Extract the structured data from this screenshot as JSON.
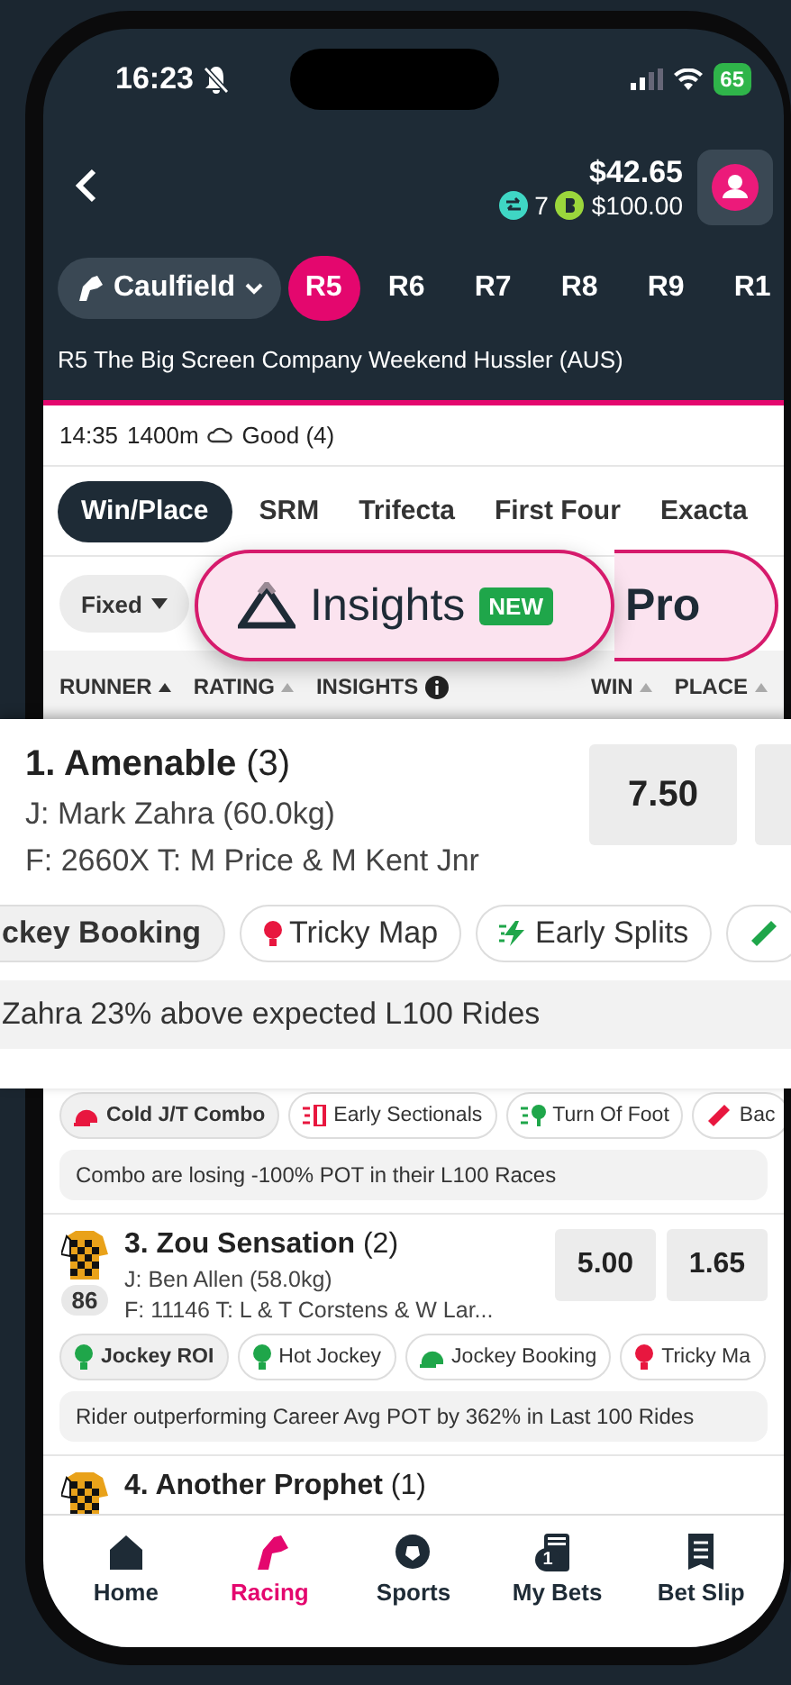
{
  "status_bar": {
    "time": "16:23",
    "battery": "65"
  },
  "header": {
    "balance": "$42.65",
    "bonus_count": "7",
    "bonus_cash": "$100.00"
  },
  "venue": {
    "label": "Caulfield"
  },
  "races": [
    {
      "label": "R5",
      "selected": true
    },
    {
      "label": "R6",
      "selected": false
    },
    {
      "label": "R7",
      "selected": false
    },
    {
      "label": "R8",
      "selected": false
    },
    {
      "label": "R9",
      "selected": false
    },
    {
      "label": "R1",
      "selected": false
    }
  ],
  "race_title": "R5 The Big Screen Company Weekend Hussler (AUS)",
  "race_info": {
    "time": "14:35",
    "distance": "1400m",
    "track": "Good (4)"
  },
  "bet_types": [
    {
      "label": "Win/Place",
      "selected": true
    },
    {
      "label": "SRM",
      "selected": false
    },
    {
      "label": "Trifecta",
      "selected": false
    },
    {
      "label": "First Four",
      "selected": false
    },
    {
      "label": "Exacta",
      "selected": false
    }
  ],
  "price_type": "Fixed",
  "insights_toggle": {
    "insights": "Insights",
    "badge": "NEW",
    "pro": "Pro"
  },
  "columns": [
    {
      "label": "RUNNER",
      "kind": "sort"
    },
    {
      "label": "RATING",
      "kind": "sort"
    },
    {
      "label": "INSIGHTS",
      "kind": "info"
    },
    {
      "label": "WIN",
      "kind": "sort"
    },
    {
      "label": "PLACE",
      "kind": "sort"
    }
  ],
  "highlighted_runner": {
    "name": "1. Amenable",
    "barrier": "(3)",
    "jockey": "J: Mark Zahra (60.0kg)",
    "form_trainer": "F: 2660X T: M Price & M Kent Jnr",
    "odds": [
      "7.50"
    ],
    "insights": [
      {
        "label": "ckey Booking",
        "kind": "none",
        "selected": true
      },
      {
        "label": "Tricky Map",
        "kind": "bulb",
        "color": "#e8173f",
        "selected": false
      },
      {
        "label": "Early Splits",
        "kind": "bolt",
        "color": "#1fa64a",
        "selected": false
      },
      {
        "kind": "ruler",
        "color": "#1fa64a",
        "selected": false
      }
    ],
    "comment": "Zahra 23% above expected L100 Rides"
  },
  "runners": [
    {
      "insights": [
        {
          "label": "Cold J/T Combo",
          "kind": "helmet",
          "color": "#e8173f",
          "selected": true
        },
        {
          "label": "Early Sectionals",
          "kind": "sectional",
          "color": "#e8173f",
          "selected": false
        },
        {
          "label": "Turn Of Foot",
          "kind": "pin",
          "color": "#1fa64a",
          "selected": false
        },
        {
          "label": "Bac",
          "kind": "ticket",
          "color": "#e8173f",
          "selected": false
        }
      ],
      "comment": "Combo are losing -100% POT in their L100 Races"
    },
    {
      "name": "3. Zou Sensation",
      "barrier": "(2)",
      "rating": "86",
      "jockey": "J: Ben Allen (58.0kg)",
      "form_trainer": "F: 11146  T: L & T Corstens & W Lar...",
      "odds": [
        "5.00",
        "1.65"
      ],
      "insights": [
        {
          "label": "Jockey ROI",
          "kind": "bulb",
          "color": "#1fa64a",
          "selected": true
        },
        {
          "label": "Hot Jockey",
          "kind": "bulb",
          "color": "#1fa64a",
          "selected": false
        },
        {
          "label": "Jockey Booking",
          "kind": "helmet",
          "color": "#1fa64a",
          "selected": false
        },
        {
          "label": "Tricky Ma",
          "kind": "bulb",
          "color": "#e8173f",
          "selected": false
        }
      ],
      "comment": "Rider outperforming Career Avg POT by 362% in Last 100 Rides"
    },
    {
      "name": "4. Another Prophet",
      "barrier": "(1)"
    }
  ],
  "nav": [
    {
      "label": "Home",
      "kind": "home",
      "selected": false
    },
    {
      "label": "Racing",
      "kind": "horse",
      "selected": true
    },
    {
      "label": "Sports",
      "kind": "ball",
      "selected": false
    },
    {
      "label": "My Bets",
      "kind": "bets",
      "badge": "1",
      "selected": false
    },
    {
      "label": "Bet Slip",
      "kind": "slip",
      "selected": false
    }
  ]
}
